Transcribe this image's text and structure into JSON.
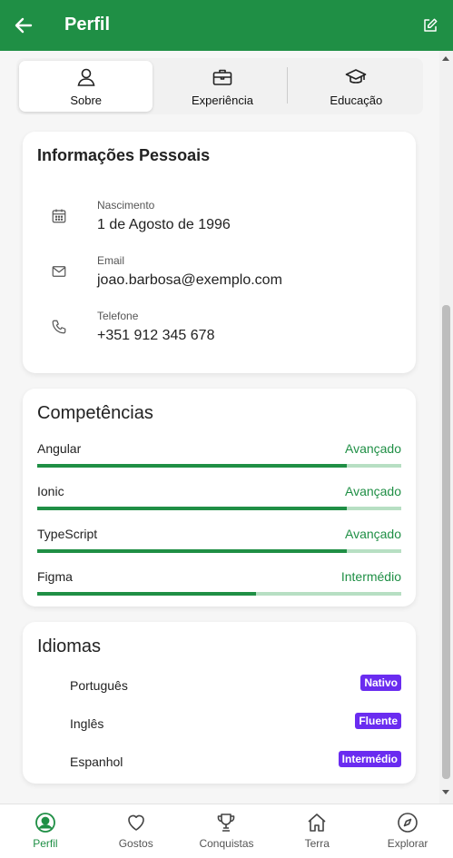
{
  "header": {
    "title": "Perfil"
  },
  "tabs": [
    {
      "label": "Sobre",
      "icon": "person-icon",
      "active": true
    },
    {
      "label": "Experiência",
      "icon": "briefcase-icon",
      "active": false
    },
    {
      "label": "Educação",
      "icon": "graduation-cap-icon",
      "active": false
    }
  ],
  "personal": {
    "title": "Informações Pessoais",
    "rows": [
      {
        "label": "Nascimento",
        "value": "1 de Agosto de 1996",
        "icon": "calendar-icon"
      },
      {
        "label": "Email",
        "value": "joao.barbosa@exemplo.com",
        "icon": "mail-icon"
      },
      {
        "label": "Telefone",
        "value": "+351 912 345 678",
        "icon": "phone-icon"
      }
    ]
  },
  "skills": {
    "title": "Competências",
    "items": [
      {
        "name": "Angular",
        "level": "Avançado",
        "progress": 0.85
      },
      {
        "name": "Ionic",
        "level": "Avançado",
        "progress": 0.85
      },
      {
        "name": "TypeScript",
        "level": "Avançado",
        "progress": 0.85
      },
      {
        "name": "Figma",
        "level": "Intermédio",
        "progress": 0.6
      }
    ]
  },
  "languages": {
    "title": "Idiomas",
    "items": [
      {
        "name": "Português",
        "badge": "Nativo"
      },
      {
        "name": "Inglês",
        "badge": "Fluente"
      },
      {
        "name": "Espanhol",
        "badge": "Intermédio"
      }
    ]
  },
  "nav": [
    {
      "label": "Perfil",
      "icon": "person-circle-icon",
      "active": true
    },
    {
      "label": "Gostos",
      "icon": "heart-icon",
      "active": false
    },
    {
      "label": "Conquistas",
      "icon": "trophy-icon",
      "active": false
    },
    {
      "label": "Terra",
      "icon": "home-icon",
      "active": false
    },
    {
      "label": "Explorar",
      "icon": "compass-icon",
      "active": false
    }
  ],
  "colors": {
    "primary": "#1f8f45",
    "badge": "#6a2cf0",
    "bar_track": "#b7dfc3"
  }
}
